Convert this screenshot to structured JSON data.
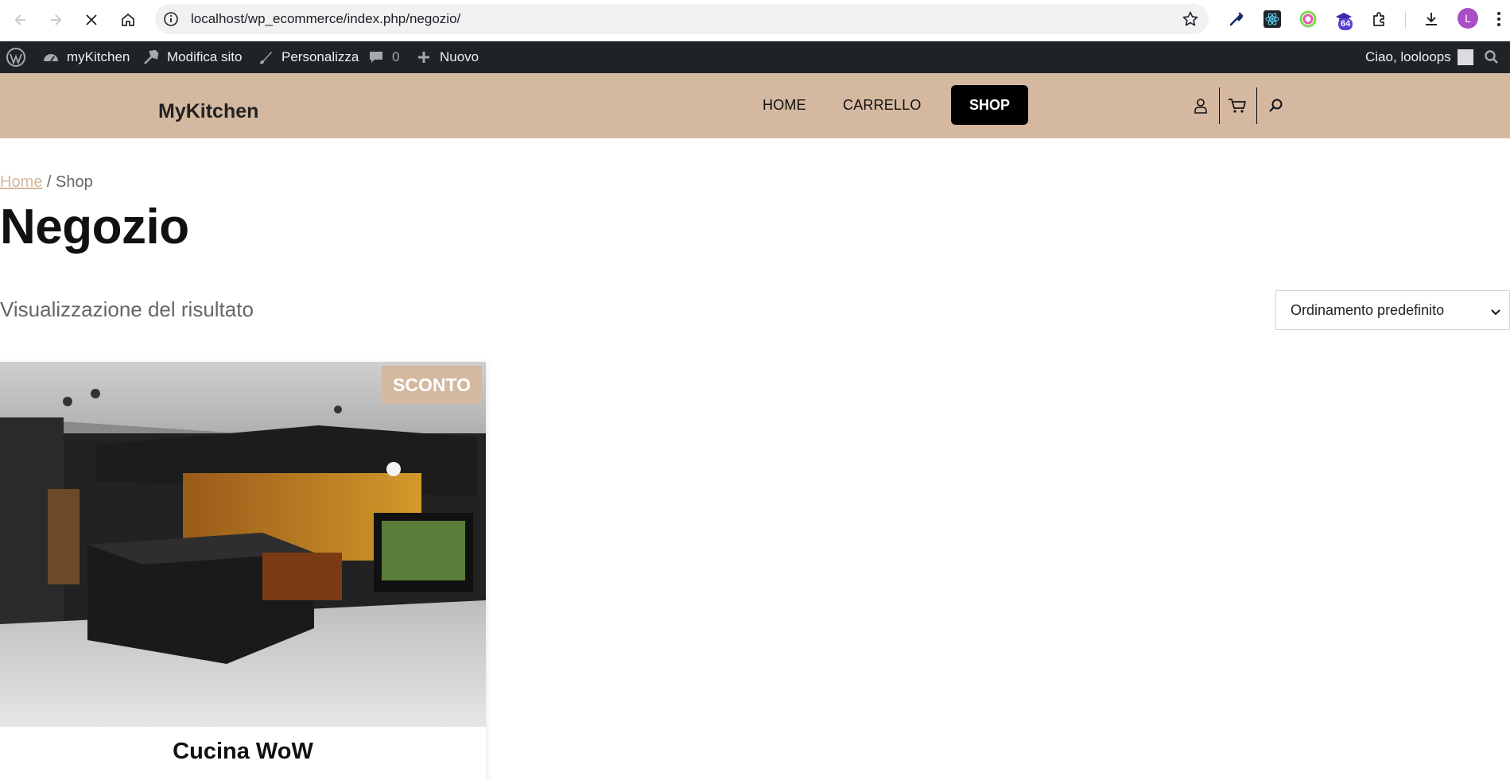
{
  "browser": {
    "url": "localhost/wp_ecommerce/index.php/negozio/",
    "extension_badge": "64",
    "profile_initial": "L",
    "icons": [
      "back-icon",
      "forward-icon",
      "stop-icon",
      "home-icon",
      "info-icon",
      "star-icon",
      "eyedropper-icon",
      "react-icon",
      "colorful-extension-icon",
      "graduation-cap-icon",
      "puzzle-icon",
      "download-icon",
      "more-vert-icon"
    ]
  },
  "adminbar": {
    "site_name": "myKitchen",
    "edit_site": "Modifica sito",
    "customize": "Personalizza",
    "comments_count": "0",
    "new": "Nuovo",
    "greeting": "Ciao, looloops"
  },
  "header": {
    "site_title": "MyKitchen",
    "menu": {
      "home": "HOME",
      "cart": "CARRELLO",
      "shop": "SHOP"
    }
  },
  "breadcrumb": {
    "home": "Home",
    "separator": " / ",
    "current": "Shop"
  },
  "page": {
    "title": "Negozio",
    "result_count": "Visualizzazione del risultato",
    "orderby_selected": "Ordinamento predefinito"
  },
  "products": [
    {
      "title": "Cucina WoW",
      "badge": "SCONTO"
    }
  ],
  "colors": {
    "header_bg": "#d4b8a0",
    "adminbar_bg": "#1d2327",
    "accent": "#d4b8a0"
  }
}
